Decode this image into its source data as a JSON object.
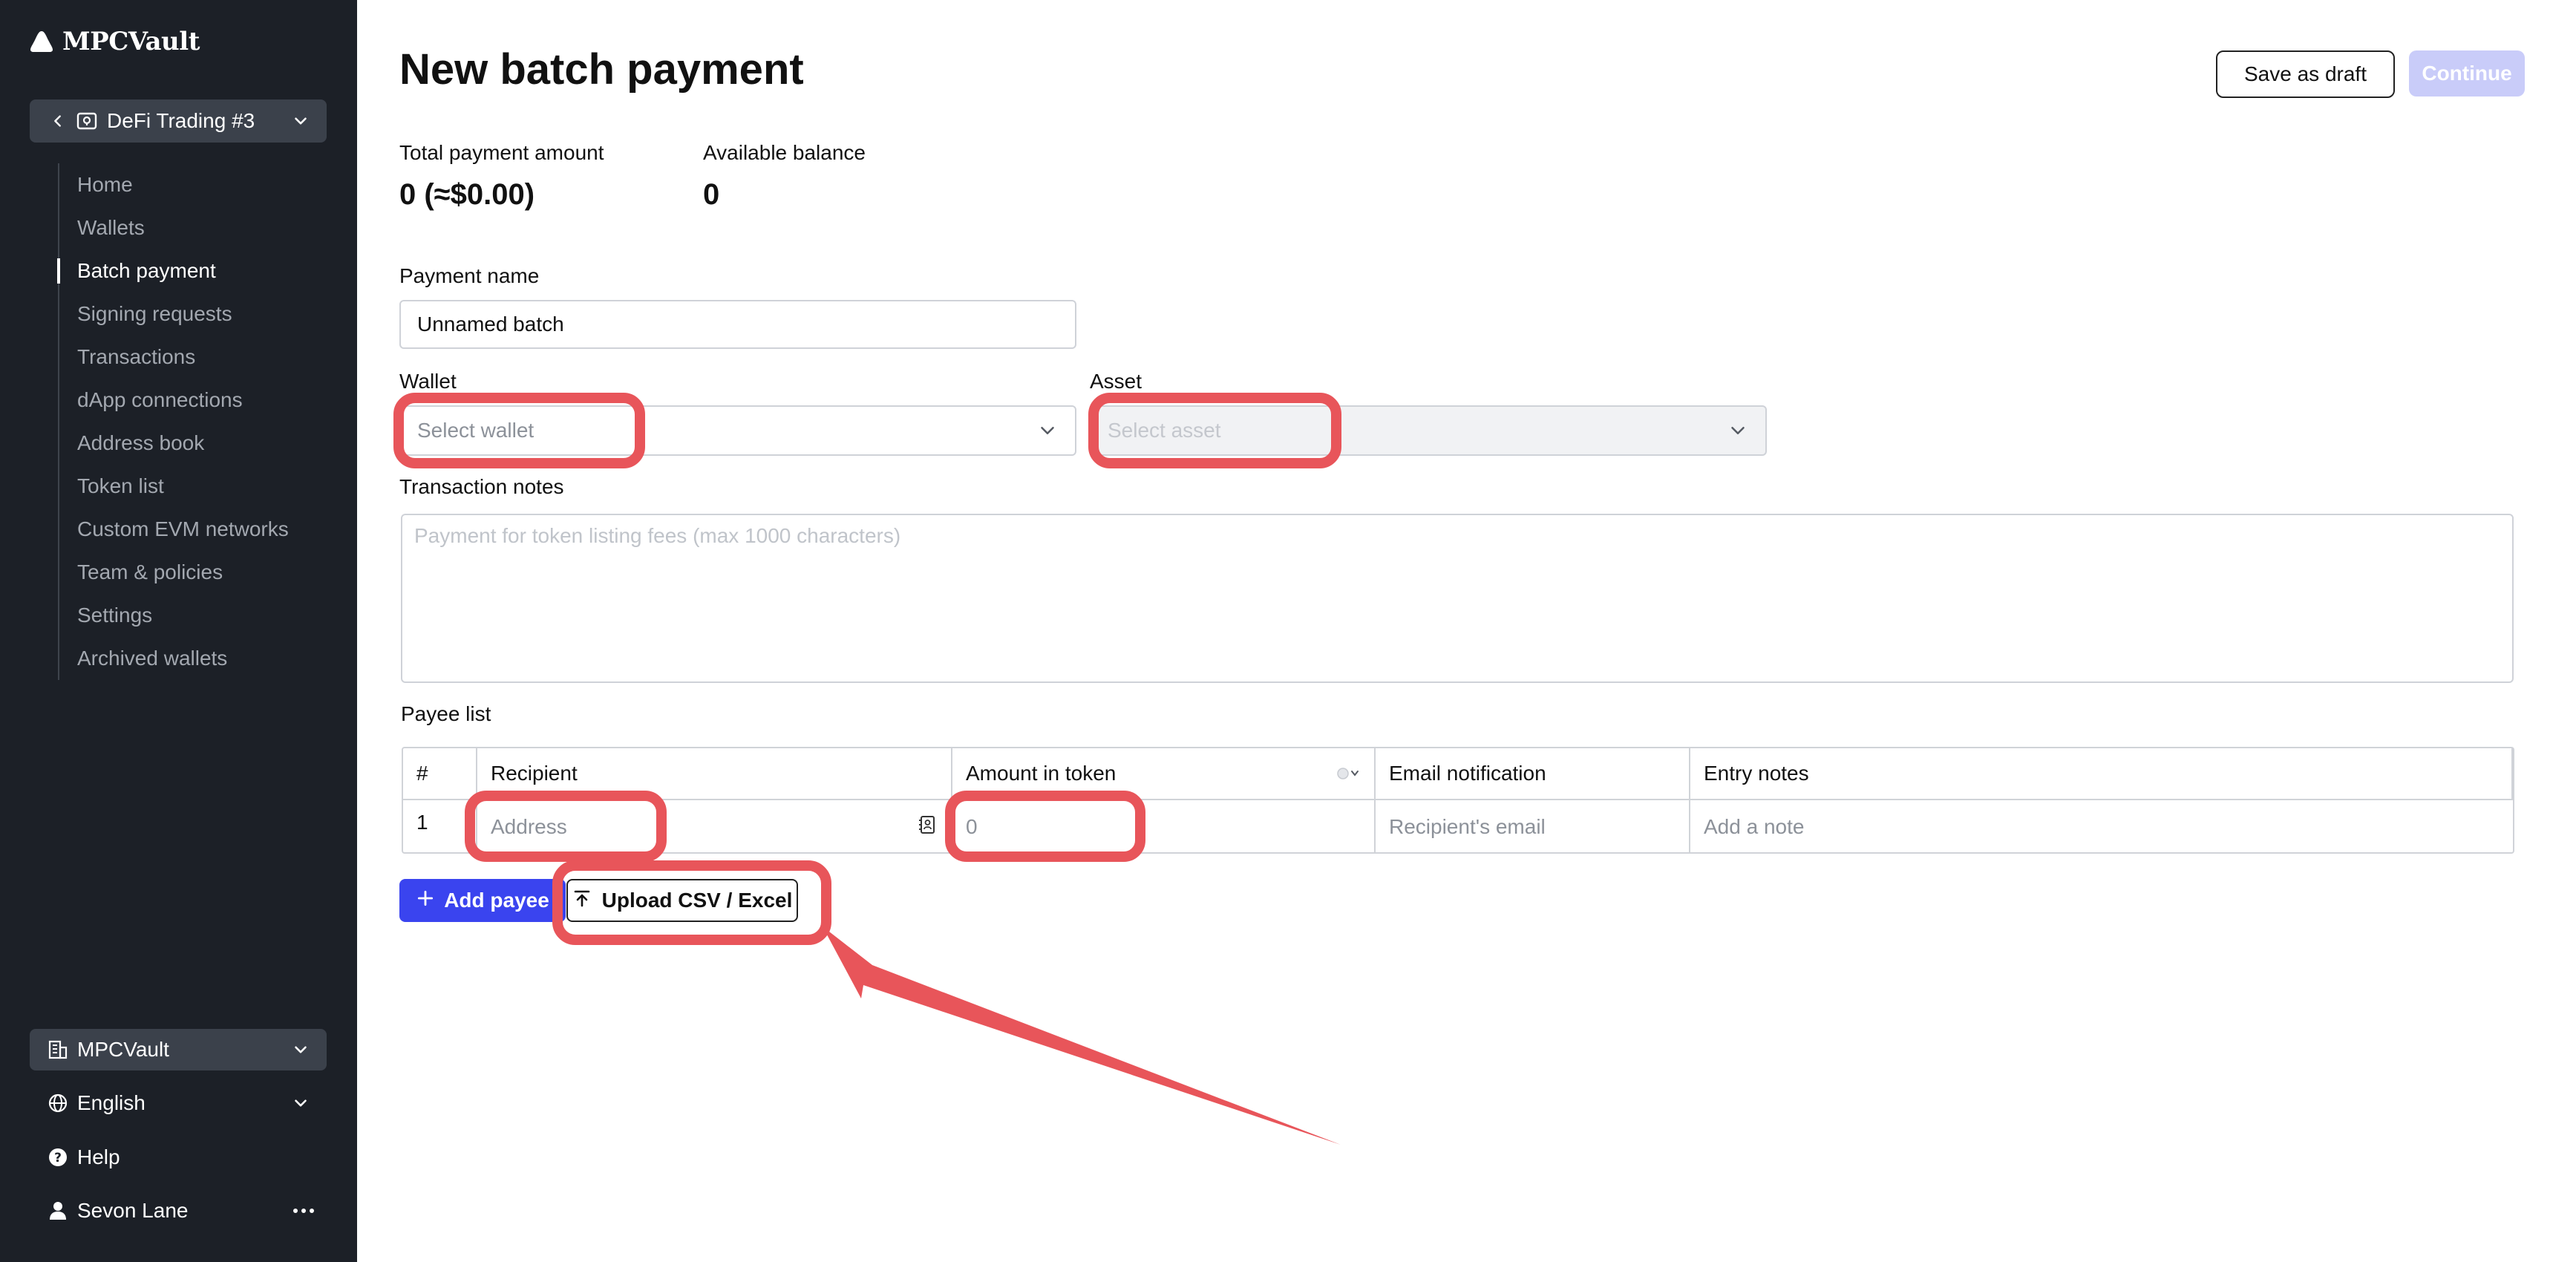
{
  "app": {
    "logo_text": "MPCVault"
  },
  "sidebar": {
    "vault_name": "DeFi Trading #3",
    "items": [
      {
        "label": "Home",
        "active": false
      },
      {
        "label": "Wallets",
        "active": false
      },
      {
        "label": "Batch payment",
        "active": true
      },
      {
        "label": "Signing requests",
        "active": false
      },
      {
        "label": "Transactions",
        "active": false
      },
      {
        "label": "dApp connections",
        "active": false
      },
      {
        "label": "Address book",
        "active": false
      },
      {
        "label": "Token list",
        "active": false
      },
      {
        "label": "Custom EVM networks",
        "active": false
      },
      {
        "label": "Team & policies",
        "active": false
      },
      {
        "label": "Settings",
        "active": false
      },
      {
        "label": "Archived wallets",
        "active": false
      }
    ],
    "org": "MPCVault",
    "language": "English",
    "help": "Help",
    "user": "Sevon Lane"
  },
  "header": {
    "title": "New batch payment",
    "save_draft": "Save as draft",
    "continue": "Continue"
  },
  "summary": {
    "total_label": "Total payment amount",
    "total_value": "0 (≈$0.00)",
    "balance_label": "Available balance",
    "balance_value": "0"
  },
  "form": {
    "payment_name_label": "Payment name",
    "payment_name_value": "Unnamed batch",
    "wallet_label": "Wallet",
    "wallet_placeholder": "Select wallet",
    "asset_label": "Asset",
    "asset_placeholder": "Select asset",
    "notes_label": "Transaction notes",
    "notes_placeholder": "Payment for token listing fees  (max 1000 characters)"
  },
  "payee": {
    "section_label": "Payee list",
    "columns": [
      "#",
      "Recipient",
      "Amount in token",
      "Email notification",
      "Entry notes"
    ],
    "rows": [
      {
        "num": "1",
        "address_placeholder": "Address",
        "amount_placeholder": "0",
        "email_placeholder": "Recipient's email",
        "note_placeholder": "Add a note"
      }
    ],
    "add_button": "Add payee",
    "upload_button": "Upload CSV / Excel"
  },
  "annotation": {
    "color": "#e8555a"
  }
}
